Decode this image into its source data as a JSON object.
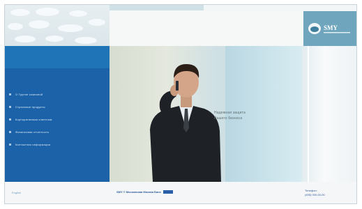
{
  "brand": {
    "logo_text": "SMY",
    "accent_color": "#1b62a8",
    "logo_color": "#6fa6bd"
  },
  "menu": {
    "items": [
      {
        "label": "О Группе компаний"
      },
      {
        "label": "Страховые продукты"
      },
      {
        "label": "Корпоративным клиентам"
      },
      {
        "label": "Финансовая отчетность"
      },
      {
        "label": "Контактная информация"
      }
    ]
  },
  "hero": {
    "tagline_line1": "Надежная защита",
    "tagline_line2": "Вашего бизнеса"
  },
  "footer": {
    "left_link": "English",
    "center_text": "SMY © Московская Москва Банк",
    "right_line1": "Телефон:",
    "right_line2": "(495) 000-00-00"
  }
}
